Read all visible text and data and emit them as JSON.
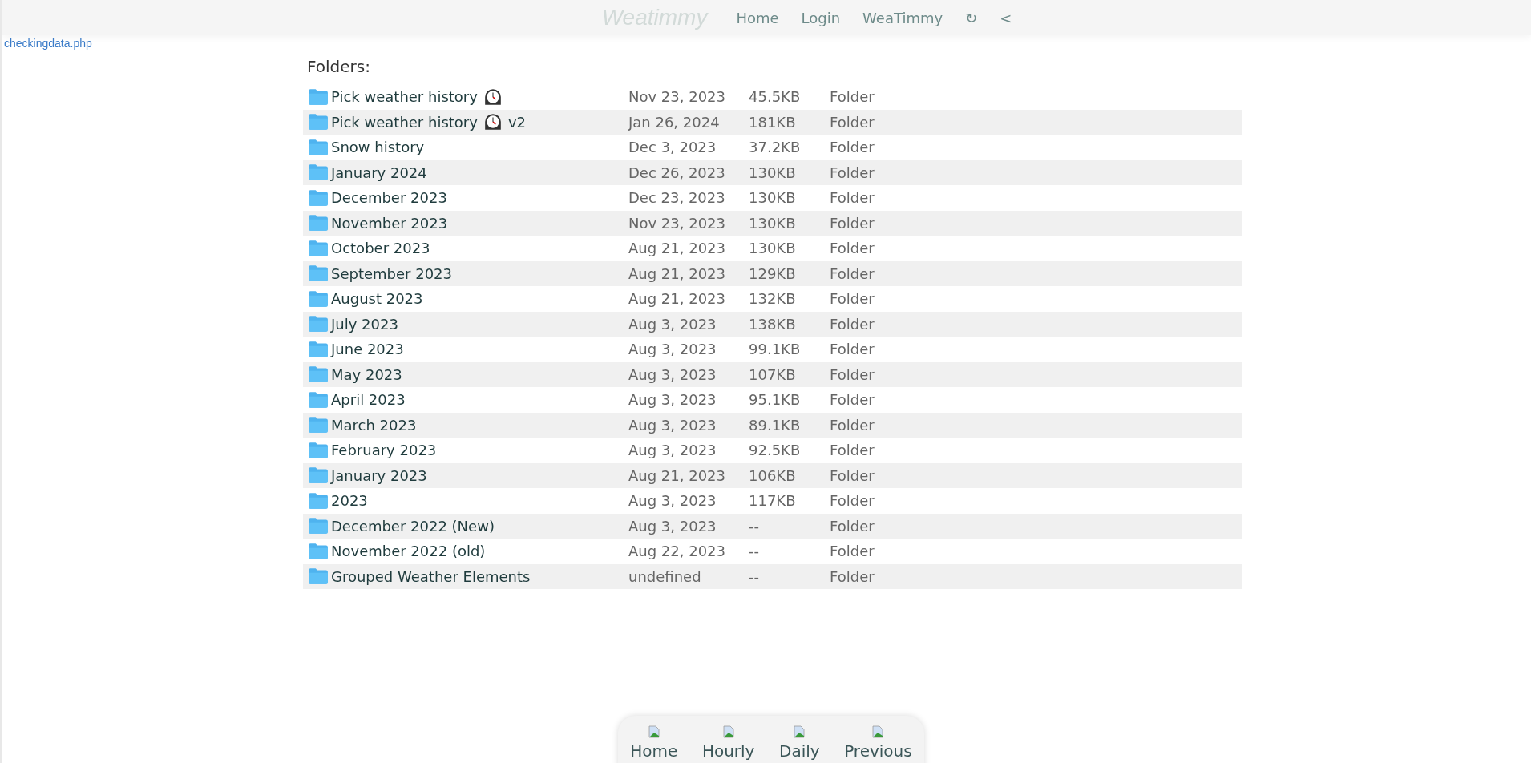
{
  "header": {
    "logo": "Weatimmy",
    "nav": [
      "Home",
      "Login",
      "WeaTimmy",
      "↻",
      "<"
    ]
  },
  "page_link": "checkingdata.php",
  "folders_heading": "Folders:",
  "rows": [
    {
      "name": "Pick weather history",
      "clock": true,
      "suffix": "",
      "date": "Nov 23, 2023",
      "size": "45.5KB",
      "type": "Folder"
    },
    {
      "name": "Pick weather history",
      "clock": true,
      "suffix": "v2",
      "date": "Jan 26, 2024",
      "size": "181KB",
      "type": "Folder"
    },
    {
      "name": "Snow history",
      "clock": false,
      "suffix": "",
      "date": "Dec 3, 2023",
      "size": "37.2KB",
      "type": "Folder"
    },
    {
      "name": "January 2024",
      "clock": false,
      "suffix": "",
      "date": "Dec 26, 2023",
      "size": "130KB",
      "type": "Folder"
    },
    {
      "name": "December 2023",
      "clock": false,
      "suffix": "",
      "date": "Dec 23, 2023",
      "size": "130KB",
      "type": "Folder"
    },
    {
      "name": "November 2023",
      "clock": false,
      "suffix": "",
      "date": "Nov 23, 2023",
      "size": "130KB",
      "type": "Folder"
    },
    {
      "name": "October 2023",
      "clock": false,
      "suffix": "",
      "date": "Aug 21, 2023",
      "size": "130KB",
      "type": "Folder"
    },
    {
      "name": "September 2023",
      "clock": false,
      "suffix": "",
      "date": "Aug 21, 2023",
      "size": "129KB",
      "type": "Folder"
    },
    {
      "name": "August 2023",
      "clock": false,
      "suffix": "",
      "date": "Aug 21, 2023",
      "size": "132KB",
      "type": "Folder"
    },
    {
      "name": "July 2023",
      "clock": false,
      "suffix": "",
      "date": "Aug 3, 2023",
      "size": "138KB",
      "type": "Folder"
    },
    {
      "name": "June 2023",
      "clock": false,
      "suffix": "",
      "date": "Aug 3, 2023",
      "size": "99.1KB",
      "type": "Folder"
    },
    {
      "name": "May 2023",
      "clock": false,
      "suffix": "",
      "date": "Aug 3, 2023",
      "size": "107KB",
      "type": "Folder"
    },
    {
      "name": "April 2023",
      "clock": false,
      "suffix": "",
      "date": "Aug 3, 2023",
      "size": "95.1KB",
      "type": "Folder"
    },
    {
      "name": "March 2023",
      "clock": false,
      "suffix": "",
      "date": "Aug 3, 2023",
      "size": "89.1KB",
      "type": "Folder"
    },
    {
      "name": "February 2023",
      "clock": false,
      "suffix": "",
      "date": "Aug 3, 2023",
      "size": "92.5KB",
      "type": "Folder"
    },
    {
      "name": "January 2023",
      "clock": false,
      "suffix": "",
      "date": "Aug 21, 2023",
      "size": "106KB",
      "type": "Folder"
    },
    {
      "name": "2023",
      "clock": false,
      "suffix": "",
      "date": "Aug 3, 2023",
      "size": "117KB",
      "type": "Folder"
    },
    {
      "name": "December 2022 (New)",
      "clock": false,
      "suffix": "",
      "date": "Aug 3, 2023",
      "size": "--",
      "type": "Folder"
    },
    {
      "name": "November 2022 (old)",
      "clock": false,
      "suffix": "",
      "date": "Aug 22, 2023",
      "size": "--",
      "type": "Folder"
    },
    {
      "name": "Grouped Weather Elements",
      "clock": false,
      "suffix": "",
      "date": "undefined",
      "size": "--",
      "type": "Folder"
    }
  ],
  "bottom_nav": [
    "Home",
    "Hourly",
    "Daily",
    "Previous"
  ]
}
